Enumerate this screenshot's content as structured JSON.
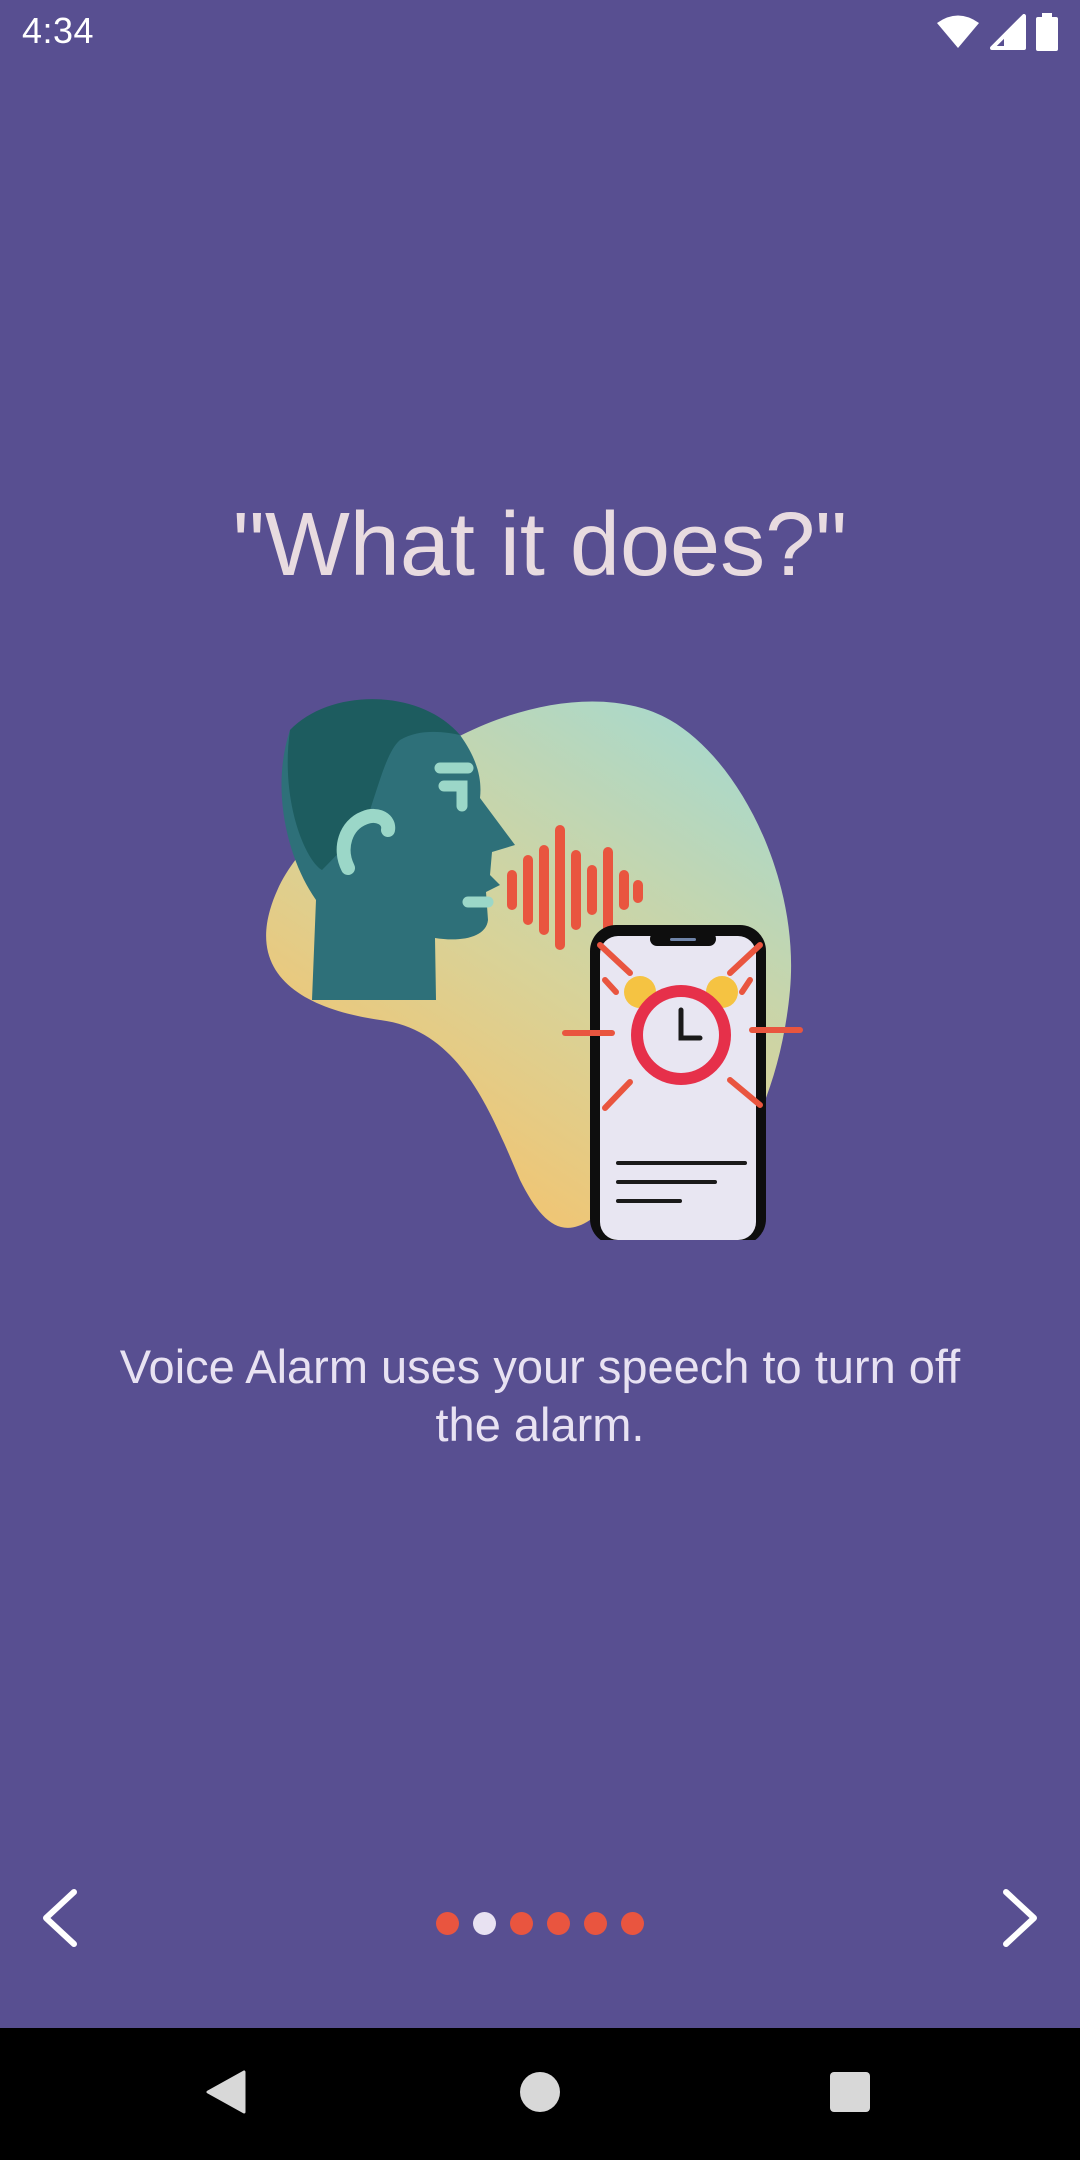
{
  "status_bar": {
    "time": "4:34",
    "icons": [
      "wifi-icon",
      "cell-signal-icon",
      "battery-icon"
    ]
  },
  "onboarding": {
    "title": "\"What it does?\"",
    "illustration": "person-speaking-to-phone-alarm-illustration",
    "description": "Voice Alarm uses your speech to turn off the alarm.",
    "page_count": 6,
    "current_page": 2
  },
  "navigation": {
    "prev_icon": "chevron-left-icon",
    "next_icon": "chevron-right-icon"
  },
  "system_nav": {
    "back_icon": "back-triangle-icon",
    "home_icon": "home-circle-icon",
    "recent_icon": "recent-apps-square-icon"
  },
  "colors": {
    "background": "#584F91",
    "title": "#E8DBE0",
    "dot_inactive": "#E9553F",
    "dot_active": "#E8E2F2"
  }
}
